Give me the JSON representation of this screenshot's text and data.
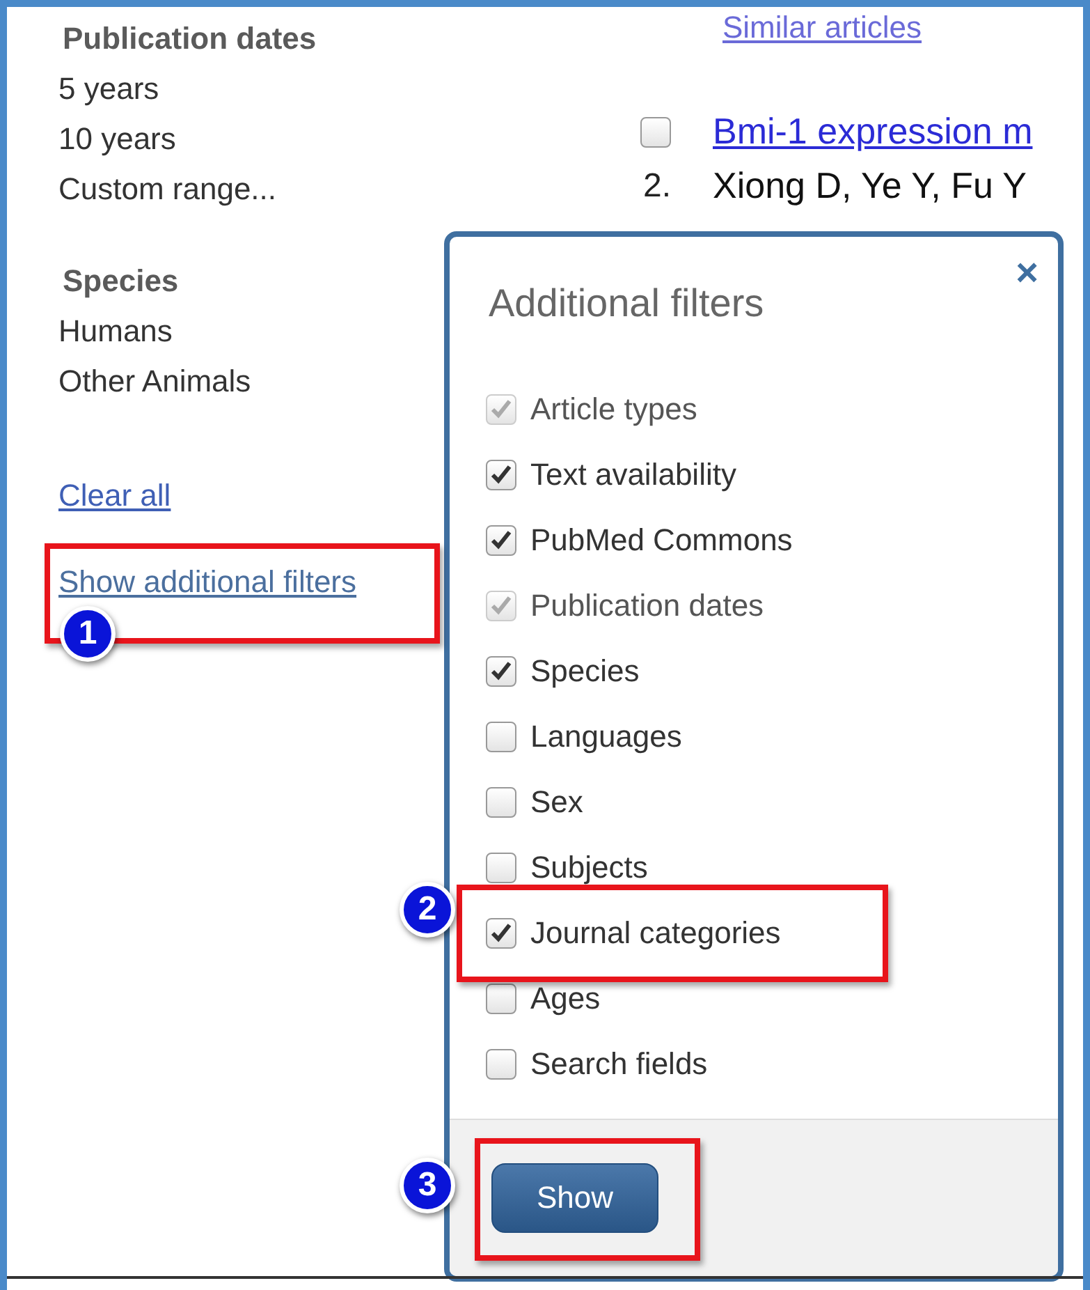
{
  "sidebar": {
    "groups": [
      {
        "heading": "Publication dates",
        "items": [
          "5 years",
          "10 years",
          "Custom range..."
        ]
      },
      {
        "heading": "Species",
        "items": [
          "Humans",
          "Other Animals"
        ]
      }
    ],
    "clear_link": "Clear all",
    "more_link": "Show additional filters"
  },
  "results": {
    "similar_link": "Similar articles",
    "item": {
      "selected": false,
      "title": "Bmi-1 expression m",
      "number": "2.",
      "authors": "Xiong D, Ye Y, Fu Y"
    }
  },
  "dialog": {
    "title": "Additional filters",
    "close": "×",
    "options": [
      {
        "label": "Article types",
        "checked": true,
        "disabled": true
      },
      {
        "label": "Text availability",
        "checked": true,
        "disabled": false
      },
      {
        "label": "PubMed Commons",
        "checked": true,
        "disabled": false
      },
      {
        "label": "Publication dates",
        "checked": true,
        "disabled": true
      },
      {
        "label": "Species",
        "checked": true,
        "disabled": false
      },
      {
        "label": "Languages",
        "checked": false,
        "disabled": false
      },
      {
        "label": "Sex",
        "checked": false,
        "disabled": false
      },
      {
        "label": "Subjects",
        "checked": false,
        "disabled": false
      },
      {
        "label": "Journal categories",
        "checked": true,
        "disabled": false
      },
      {
        "label": "Ages",
        "checked": false,
        "disabled": false
      },
      {
        "label": "Search fields",
        "checked": false,
        "disabled": false
      }
    ],
    "button": "Show"
  },
  "annotations": [
    "1",
    "2",
    "3"
  ]
}
